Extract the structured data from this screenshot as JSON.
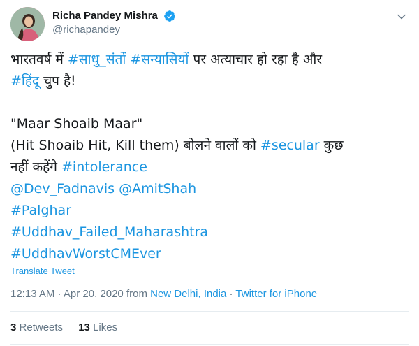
{
  "author": {
    "display_name": "Richa Pandey Mishra",
    "handle": "@richapandey",
    "verified_icon": "verified-badge-icon",
    "avatar_icon": "profile-photo"
  },
  "tweet": {
    "line1": {
      "t1": "भारतवर्ष में ",
      "h1": "#साधु_संतों",
      "t2": " ",
      "h2": "#सन्यासियों",
      "t3": " पर अत्याचार हो रहा है और"
    },
    "line2": {
      "h1": "#हिंदू",
      "t1": " चुप है!"
    },
    "line3": "\"Maar Shoaib Maar\"",
    "line4": {
      "t1": "(Hit Shoaib Hit, Kill them)  बोलने वालों को ",
      "h1": "#secular",
      "t2": " कुछ"
    },
    "line5": {
      "t1": "नहीं कहेंगे ",
      "h1": "#intolerance"
    },
    "line6": {
      "m1": "@Dev_Fadnavis",
      "t1": " ",
      "m2": "@AmitShah"
    },
    "line7": "#Palghar",
    "line8": "#Uddhav_Failed_Maharashtra",
    "line9": "#UddhavWorstCMEver"
  },
  "translate_label": "Translate Tweet",
  "meta": {
    "time": "12:13 AM · Apr 20, 2020 from ",
    "location": "New Delhi, India",
    "separator": " · ",
    "source": "Twitter for iPhone"
  },
  "stats": {
    "retweets_count": "3",
    "retweets_label": "Retweets",
    "likes_count": "13",
    "likes_label": "Likes"
  },
  "colors": {
    "link": "#1b95e0",
    "text": "#14171a",
    "muted": "#657786",
    "divider": "#e6ecf0"
  }
}
